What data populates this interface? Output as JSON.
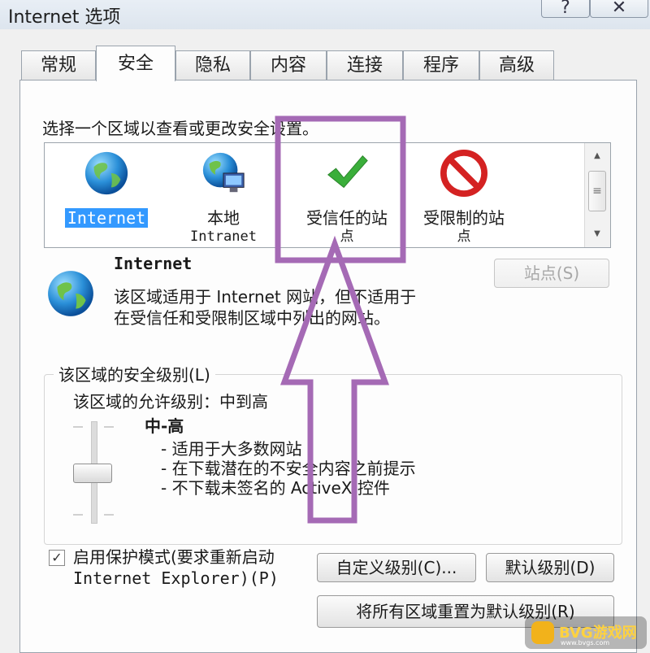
{
  "window": {
    "title": "Internet 选项",
    "help": "?",
    "close": "✕"
  },
  "tabs": [
    {
      "label": "常规"
    },
    {
      "label": "安全"
    },
    {
      "label": "隐私"
    },
    {
      "label": "内容"
    },
    {
      "label": "连接"
    },
    {
      "label": "程序"
    },
    {
      "label": "高级"
    }
  ],
  "security": {
    "zone_prompt": "选择一个区域以查看或更改安全设置。",
    "zones": [
      {
        "label": "Internet",
        "sub": "",
        "icon": "globe-icon"
      },
      {
        "label": "本地",
        "sub": "Intranet",
        "icon": "intranet-globe-icon"
      },
      {
        "label": "受信任的站",
        "sub": "点",
        "icon": "checkmark-icon"
      },
      {
        "label": "受限制的站",
        "sub": "点",
        "icon": "no-entry-icon"
      }
    ],
    "selected_zone": {
      "name": "Internet",
      "description_1": "该区域适用于 Internet 网站，但不适用于",
      "description_2": "在受信任和受限制区域中列出的网站。",
      "sites_button": "站点(S)"
    },
    "level_group": {
      "legend": "该区域的安全级别(L)",
      "allowed": "该区域的允许级别：中到高",
      "level_name": "中-高",
      "bullets": [
        "- 适用于大多数网站",
        "- 在下载潜在的不安全内容之前提示",
        "- 不下载未签名的 ActiveX 控件"
      ]
    },
    "protected_mode": {
      "checked": true,
      "line1": "启用保护模式(要求重新启动",
      "line2": "Internet Explorer)(P)"
    },
    "custom_level_button": "自定义级别(C)...",
    "default_level_button": "默认级别(D)",
    "reset_all_button": "将所有区域重置为默认级别(R)"
  },
  "colors": {
    "annotation": "#a56ab5",
    "selection": "#3399ff"
  },
  "watermark": {
    "text": "BVG游戏网",
    "url": "www.bvgs.com"
  }
}
